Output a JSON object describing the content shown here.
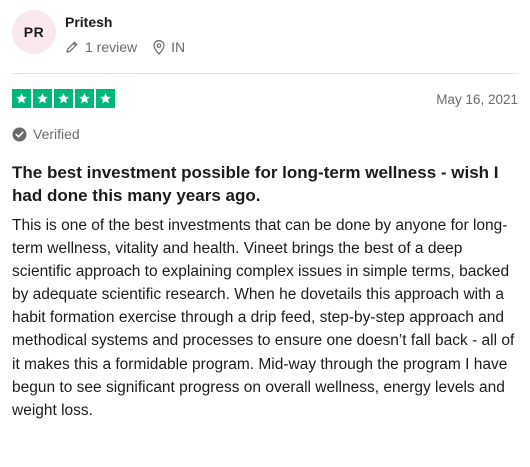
{
  "reviewer": {
    "initials": "PR",
    "name": "Pritesh",
    "review_count": "1 review",
    "location": "IN"
  },
  "rating": {
    "stars": 5,
    "max": 5,
    "color": "#00b67a"
  },
  "date": "May 16, 2021",
  "verified_label": "Verified",
  "review": {
    "title": "The best investment possible for long-term wellness - wish I had done this many years ago.",
    "body": "This is one of the best investments that can be done by anyone for long-term wellness, vitality and health. Vineet brings the best of a deep scientific approach to explaining complex issues in simple terms, backed by adequate scientific research. When he dovetails this approach with a habit formation exercise through a drip feed, step-by-step approach and methodical systems and processes to ensure one doesn’t fall back - all of it makes this a formidable program. Mid-way through the program I have begun to see significant progress on overall wellness, energy levels and weight loss."
  },
  "colors": {
    "avatar_bg": "#f9e8f0",
    "muted_text": "#6b6b6b",
    "divider": "#e5e5dd"
  }
}
